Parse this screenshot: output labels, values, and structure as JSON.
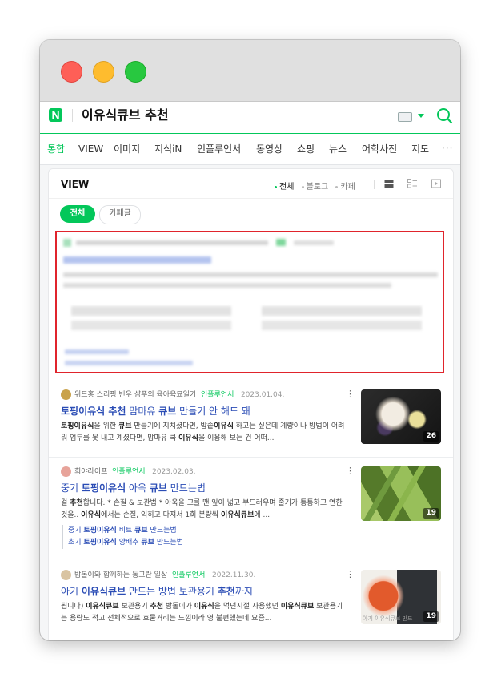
{
  "header": {
    "logo": "N",
    "query": "이유식큐브 추천"
  },
  "tabs": [
    "통합",
    "VIEW",
    "이미지",
    "지식iN",
    "인플루언서",
    "동영상",
    "쇼핑",
    "뉴스",
    "어학사전",
    "지도"
  ],
  "tabs_more": "···",
  "view": {
    "title": "VIEW",
    "filters": [
      "전체",
      "블로그",
      "카페"
    ],
    "pills": [
      "전체",
      "카페글"
    ]
  },
  "posts": [
    {
      "author": "위드홍 스리핑 빈우 샴푸의 육아육묘일기",
      "badge": "인플루언서",
      "date": "2023.01.04.",
      "title": "토핑이유식 추천 맘마유 큐브 만들기 안 해도 돼",
      "snippet": "토핑이유식을 위한 큐브 만들기에 지치셨다면, 밥솥이유식 하고는 싶은데 계량이나 방법이 어려워 엄두를 못 내고 계셨다면, 맘마유 쿡 이유식을 이용해 보는 건 어떠...",
      "count": "26"
    },
    {
      "author": "희야라이프",
      "badge": "인플루언서",
      "date": "2023.02.03.",
      "title": "중기 토핑이유식 아욱 큐브 만드는법",
      "snippet": "걸 추천합니다. * 손질 & 보관법 * 아욱을 고를 땐 잎이 넓고 부드러우며 줄기가 통통하고 연한 것을.. 이유식에서는 손질, 익히고 다져서 1회 분량씩 이유식큐브에 ...",
      "subs": [
        "중기 토핑이유식 비트 큐브 만드는법",
        "초기 토핑이유식 양배추 큐브 만드는법"
      ],
      "count": "19"
    },
    {
      "author": "밤톨이와 함께하는 동그란 일상",
      "badge": "인플루언서",
      "date": "2022.11.30.",
      "title": "아기 이유식큐브 만드는 방법 보관용기 추천까지",
      "snippet": "됩니다) 이유식큐브 보관용기 추천 밤톨이가 이유식을 먹던시절 사용했던 이유식큐브 보관용기는 용량도 적고 전체적으로 흐물거리는 느낌이라 영 불편했는데 요즘...",
      "thumb_caption": "아기 이유식큐브 만드",
      "count": "19"
    }
  ],
  "colors": {
    "accent": "#03c75a",
    "link": "#2a4cb5",
    "highlight_box": "#e0242c"
  }
}
